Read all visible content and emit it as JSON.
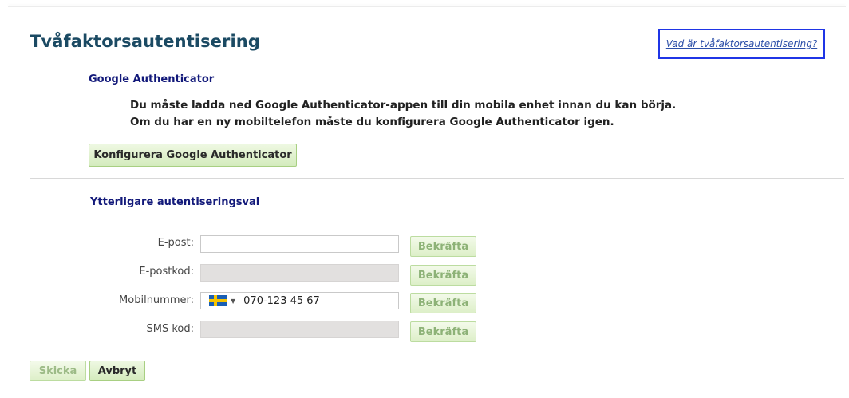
{
  "page": {
    "title": "Tvåfaktorsautentisering",
    "help_link": "Vad är tvåfaktorsautentisering?"
  },
  "google_authenticator": {
    "title": "Google Authenticator",
    "line1": "Du måste ladda ned Google Authenticator-appen till din mobila enhet innan du kan börja.",
    "line2": "Om du har en ny mobiltelefon måste du konfigurera Google Authenticator igen.",
    "configure_button": "Konfigurera Google Authenticator"
  },
  "additional": {
    "title": "Ytterligare autentiseringsval",
    "rows": [
      {
        "label": "E-post:",
        "value": "",
        "disabled": false,
        "confirm": "Bekräfta"
      },
      {
        "label": "E-postkod:",
        "value": "",
        "disabled": true,
        "confirm": "Bekräfta"
      },
      {
        "label": "Mobilnummer:",
        "value": "070-123 45 67",
        "country": "Sweden",
        "flag_icon": "sweden-flag-icon",
        "confirm": "Bekräfta"
      },
      {
        "label": "SMS kod:",
        "value": "",
        "disabled": true,
        "confirm": "Bekräfta"
      }
    ]
  },
  "actions": {
    "submit": "Skicka",
    "cancel": "Avbryt"
  },
  "colors": {
    "title": "#1b4a63",
    "section_title": "#12197a",
    "button_green": "#d4ebbd",
    "highlight_border": "#1f35e6"
  }
}
